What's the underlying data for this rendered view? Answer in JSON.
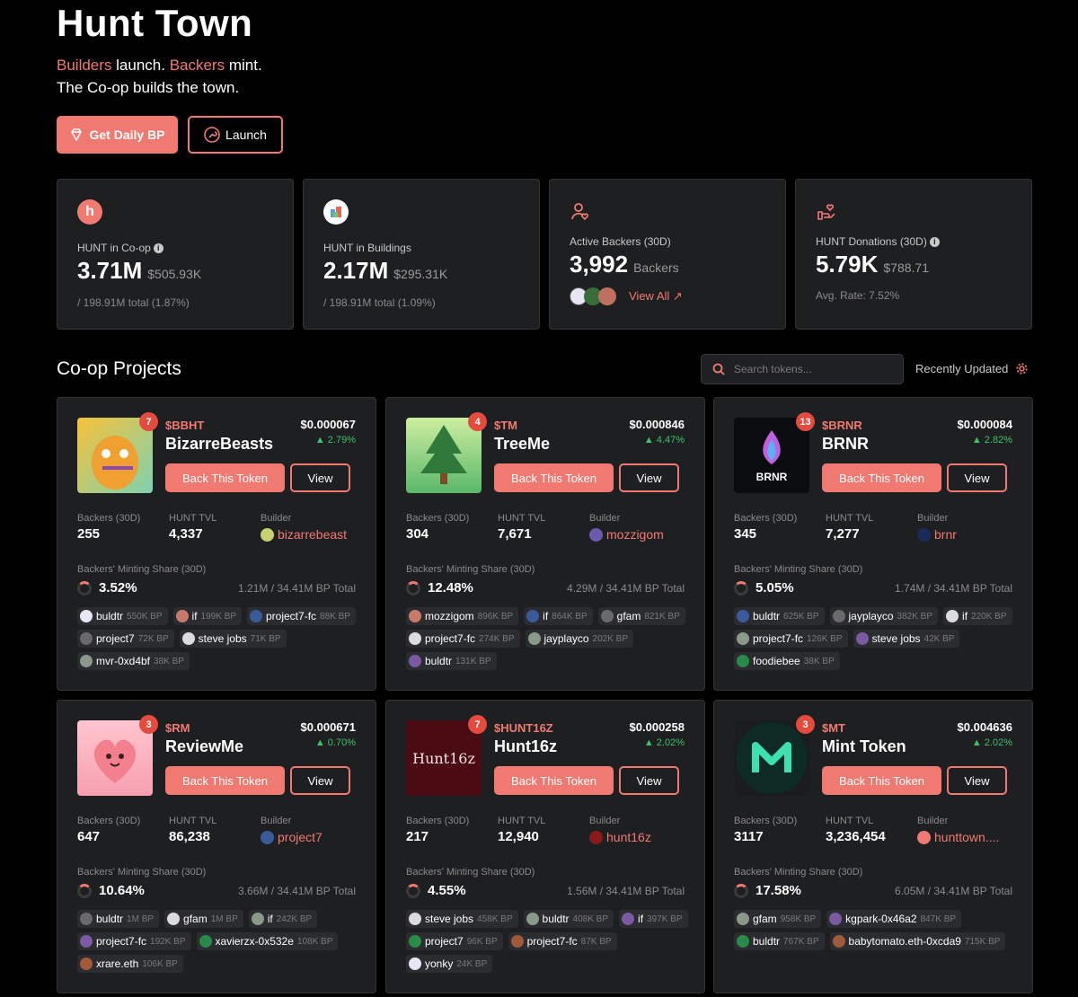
{
  "hero": {
    "title": "Hunt Town",
    "line1_a": "Builders",
    "line1_b": " launch. ",
    "line1_c": "Backers",
    "line1_d": " mint.",
    "line2": "The Co-op builds the town.",
    "daily_bp_label": "Get Daily BP",
    "launch_label": "Launch"
  },
  "stats": [
    {
      "label": "HUNT in Co-op",
      "value": "3.71M",
      "usd": "$505.93K",
      "sub": "/ 198.91M total (1.87%)"
    },
    {
      "label": "HUNT in Buildings",
      "value": "2.17M",
      "usd": "$295.31K",
      "sub": "/ 198.91M total (1.09%)"
    },
    {
      "label": "Active Backers (30D)",
      "value": "3,992",
      "usd": "Backers",
      "view_all": "View All ↗"
    },
    {
      "label": "HUNT Donations (30D)",
      "value": "5.79K",
      "usd": "$788.71",
      "sub": "Avg. Rate: 7.52%"
    }
  ],
  "projects_section": {
    "title": "Co-op Projects",
    "search_placeholder": "Search tokens...",
    "sort_label": "Recently Updated"
  },
  "labels": {
    "back": "Back This Token",
    "view": "View",
    "backers": "Backers (30D)",
    "tvl": "HUNT TVL",
    "builder": "Builder",
    "share": "Backers' Minting Share (30D)"
  },
  "colors": {
    "accent": "#f07a72",
    "positive": "#3ec26a",
    "badge": "#e54a3e"
  },
  "cards": [
    {
      "badge": "7",
      "ticker": "$BBHT",
      "name": "BizarreBeasts",
      "price": "$0.000067",
      "change": "▲ 2.79%",
      "backers": "255",
      "tvl": "4,337",
      "builder": "bizarrebeast",
      "share": "3.52%",
      "share_total": "1.21M / 34.41M BP Total",
      "chips": [
        {
          "name": "buldtr",
          "bp": "550K BP"
        },
        {
          "name": "if",
          "bp": "199K BP"
        },
        {
          "name": "project7-fc",
          "bp": "88K BP"
        },
        {
          "name": "project7",
          "bp": "72K BP"
        },
        {
          "name": "steve jobs",
          "bp": "71K BP"
        },
        {
          "name": "mvr-0xd4bf",
          "bp": "38K BP"
        }
      ]
    },
    {
      "badge": "4",
      "ticker": "$TM",
      "name": "TreeMe",
      "price": "$0.000846",
      "change": "▲ 4.47%",
      "backers": "304",
      "tvl": "7,671",
      "builder": "mozzigom",
      "share": "12.48%",
      "share_total": "4.29M / 34.41M BP Total",
      "chips": [
        {
          "name": "mozzigom",
          "bp": "896K BP"
        },
        {
          "name": "if",
          "bp": "864K BP"
        },
        {
          "name": "gfam",
          "bp": "821K BP"
        },
        {
          "name": "project7-fc",
          "bp": "274K BP"
        },
        {
          "name": "jayplayco",
          "bp": "202K BP"
        },
        {
          "name": "buldtr",
          "bp": "131K BP"
        }
      ]
    },
    {
      "badge": "13",
      "ticker": "$BRNR",
      "name": "BRNR",
      "price": "$0.000084",
      "change": "▲ 2.82%",
      "backers": "345",
      "tvl": "7,277",
      "builder": "brnr",
      "share": "5.05%",
      "share_total": "1.74M / 34.41M BP Total",
      "chips": [
        {
          "name": "buldtr",
          "bp": "625K BP"
        },
        {
          "name": "jayplayco",
          "bp": "382K BP"
        },
        {
          "name": "if",
          "bp": "220K BP"
        },
        {
          "name": "project7-fc",
          "bp": "126K BP"
        },
        {
          "name": "steve jobs",
          "bp": "42K BP"
        },
        {
          "name": "foodiebee",
          "bp": "38K BP"
        }
      ]
    },
    {
      "badge": "3",
      "ticker": "$RM",
      "name": "ReviewMe",
      "price": "$0.000671",
      "change": "▲ 0.70%",
      "backers": "647",
      "tvl": "86,238",
      "builder": "project7",
      "share": "10.64%",
      "share_total": "3.66M / 34.41M BP Total",
      "chips": [
        {
          "name": "buldtr",
          "bp": "1M BP"
        },
        {
          "name": "gfam",
          "bp": "1M BP"
        },
        {
          "name": "if",
          "bp": "242K BP"
        },
        {
          "name": "project7-fc",
          "bp": "192K BP"
        },
        {
          "name": "xavierzx-0x532e",
          "bp": "108K BP"
        },
        {
          "name": "xrare.eth",
          "bp": "106K BP"
        }
      ]
    },
    {
      "badge": "7",
      "ticker": "$HUNT16Z",
      "name": "Hunt16z",
      "price": "$0.000258",
      "change": "▲ 2.02%",
      "backers": "217",
      "tvl": "12,940",
      "builder": "hunt16z",
      "share": "4.55%",
      "share_total": "1.56M / 34.41M BP Total",
      "thumb_text": "Hunt16z",
      "chips": [
        {
          "name": "steve jobs",
          "bp": "458K BP"
        },
        {
          "name": "buldtr",
          "bp": "408K BP"
        },
        {
          "name": "if",
          "bp": "397K BP"
        },
        {
          "name": "project7",
          "bp": "96K BP"
        },
        {
          "name": "project7-fc",
          "bp": "87K BP"
        },
        {
          "name": "yonky",
          "bp": "24K BP"
        }
      ]
    },
    {
      "badge": "3",
      "ticker": "$MT",
      "name": "Mint Token",
      "price": "$0.004636",
      "change": "▲ 2.02%",
      "backers": "3117",
      "tvl": "3,236,454",
      "builder": "hunttown....",
      "share": "17.58%",
      "share_total": "6.05M / 34.41M BP Total",
      "chips": [
        {
          "name": "gfam",
          "bp": "958K BP"
        },
        {
          "name": "kgpark-0x46a2",
          "bp": "847K BP"
        },
        {
          "name": "buldtr",
          "bp": "767K BP"
        },
        {
          "name": "babytomato.eth-0xcda9",
          "bp": "715K BP"
        }
      ]
    }
  ]
}
